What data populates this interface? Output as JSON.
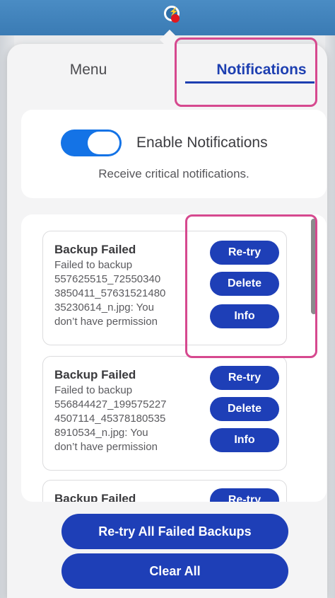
{
  "tabs": {
    "menu_label": "Menu",
    "notifications_label": "Notifications"
  },
  "settings": {
    "toggle_label": "Enable Notifications",
    "toggle_enabled": true,
    "description": "Receive critical notifications."
  },
  "notifications": [
    {
      "title": "Backup Failed",
      "lines": [
        "Failed to backup",
        "557625515_72550340",
        "3850411_57631521480",
        "35230614_n.jpg: You",
        "don’t have permission"
      ],
      "actions": [
        "Re-try",
        "Delete",
        "Info"
      ]
    },
    {
      "title": "Backup Failed",
      "lines": [
        "Failed to backup",
        "556844427_199575227",
        "4507114_45378180535",
        "8910534_n.jpg: You",
        "don’t have permission"
      ],
      "actions": [
        "Re-try",
        "Delete",
        "Info"
      ]
    },
    {
      "title": "Backup Failed",
      "actions": [
        "Re-try"
      ]
    }
  ],
  "footer": {
    "retry_all_label": "Re-try All Failed Backups",
    "clear_all_label": "Clear All"
  },
  "colors": {
    "accent": "#1e3fb7",
    "toggle_on": "#1473e6",
    "highlight": "#d6498f"
  },
  "icons": {
    "tray": "app-tray-icon-with-alert-dot"
  }
}
